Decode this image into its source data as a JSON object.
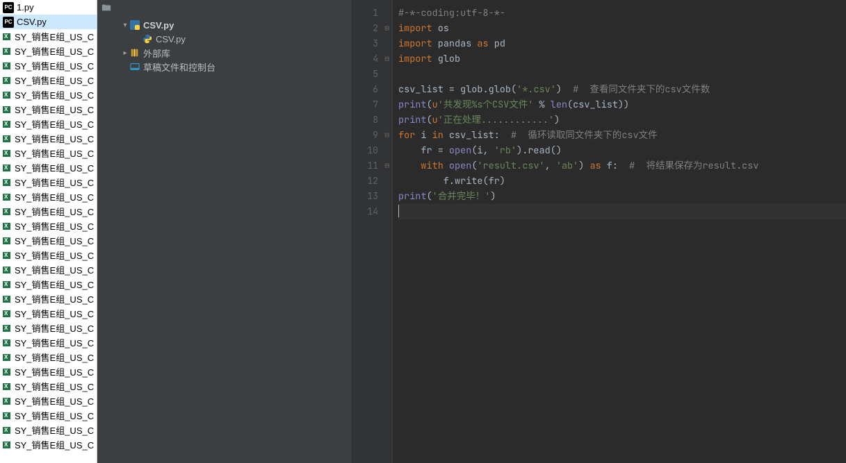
{
  "taskbar": {
    "items": [
      {
        "type": "py",
        "label": "1.py",
        "selected": false
      },
      {
        "type": "py",
        "label": "CSV.py",
        "selected": true
      },
      {
        "type": "xl",
        "label": "SY_销售E组_US_CA_..."
      },
      {
        "type": "xl",
        "label": "SY_销售E组_US_CA_..."
      },
      {
        "type": "xl",
        "label": "SY_销售E组_US_CA_..."
      },
      {
        "type": "xl",
        "label": "SY_销售E组_US_CA_..."
      },
      {
        "type": "xl",
        "label": "SY_销售E组_US_CA_..."
      },
      {
        "type": "xl",
        "label": "SY_销售E组_US_CA_..."
      },
      {
        "type": "xl",
        "label": "SY_销售E组_US_CA_..."
      },
      {
        "type": "xl",
        "label": "SY_销售E组_US_CA_..."
      },
      {
        "type": "xl",
        "label": "SY_销售E组_US_CA_..."
      },
      {
        "type": "xl",
        "label": "SY_销售E组_US_CA_..."
      },
      {
        "type": "xl",
        "label": "SY_销售E组_US_CA_..."
      },
      {
        "type": "xl",
        "label": "SY_销售E组_US_CA_..."
      },
      {
        "type": "xl",
        "label": "SY_销售E组_US_CA_..."
      },
      {
        "type": "xl",
        "label": "SY_销售E组_US_CA_..."
      },
      {
        "type": "xl",
        "label": "SY_销售E组_US_CA_..."
      },
      {
        "type": "xl",
        "label": "SY_销售E组_US_CA_..."
      },
      {
        "type": "xl",
        "label": "SY_销售E组_US_CA_..."
      },
      {
        "type": "xl",
        "label": "SY_销售E组_US_CA_..."
      },
      {
        "type": "xl",
        "label": "SY_销售E组_US_CA_..."
      },
      {
        "type": "xl",
        "label": "SY_销售E组_US_CA_..."
      },
      {
        "type": "xl",
        "label": "SY_销售E组_US_CA_..."
      },
      {
        "type": "xl",
        "label": "SY_销售E组_US_CA_..."
      },
      {
        "type": "xl",
        "label": "SY_销售E组_US_CA_..."
      },
      {
        "type": "xl",
        "label": "SY_销售E组_US_CA_..."
      },
      {
        "type": "xl",
        "label": "SY_销售E组_US_CA_..."
      },
      {
        "type": "xl",
        "label": "SY_销售E组_US_CA_..."
      },
      {
        "type": "xl",
        "label": "SY_销售E组_US_CA_..."
      },
      {
        "type": "xl",
        "label": "SY_销售E组_US_CA_..."
      },
      {
        "type": "xl",
        "label": "SY_销售E组_US_CA_..."
      }
    ]
  },
  "project": {
    "root": "CSV.py",
    "file": "CSV.py",
    "external_lib": "外部库",
    "scratches": "草稿文件和控制台"
  },
  "editor": {
    "line_count": 14,
    "code": {
      "l1_comment": "#-*-coding:utf-8-*-",
      "l2_import": "import",
      "l2_os": " os",
      "l3_import": "import",
      "l3_rest": " pandas ",
      "l3_as": "as",
      "l3_pd": " pd",
      "l4_import": "import",
      "l4_glob": " glob",
      "l6_lhs": "csv_list = glob.glob(",
      "l6_str": "'*.csv'",
      "l6_rp": ")  ",
      "l6_cmt": "#  查看同文件夹下的csv文件数",
      "l7_print": "print",
      "l7_lp": "(",
      "l7_u": "u",
      "l7_str": "'共发现%s个CSV文件'",
      "l7_mid": " % ",
      "l7_len": "len",
      "l7_args": "(csv_list))",
      "l8_print": "print",
      "l8_lp": "(",
      "l8_u": "u",
      "l8_str": "'正在处理............'",
      "l8_rp": ")",
      "l9_for": "for",
      "l9_i": " i ",
      "l9_in": "in",
      "l9_rest": " csv_list:  ",
      "l9_cmt": "#  循环读取同文件夹下的csv文件",
      "l10_pre": "    fr = ",
      "l10_open": "open",
      "l10_lp": "(i",
      "l10_c": ", ",
      "l10_str": "'rb'",
      "l10_rest": ").read()",
      "l11_pre": "    ",
      "l11_with": "with",
      "l11_sp": " ",
      "l11_open": "open",
      "l11_lp": "(",
      "l11_s1": "'result.csv'",
      "l11_c": ", ",
      "l11_s2": "'ab'",
      "l11_rp": ") ",
      "l11_as": "as",
      "l11_f": " f:  ",
      "l11_cmt": "#  将结果保存为result.csv",
      "l12_pre": "        f.write(fr)",
      "l13_print": "print",
      "l13_lp": "(",
      "l13_str": "'合并完毕！'",
      "l13_rp": ")"
    }
  },
  "colors": {
    "editor_bg": "#2b2b2b",
    "panel_bg": "#3c3f41",
    "gutter_bg": "#313335",
    "keyword": "#cc7832",
    "string": "#6a8759",
    "comment": "#808080",
    "builtin": "#8888c6",
    "text": "#a9b7c6"
  }
}
